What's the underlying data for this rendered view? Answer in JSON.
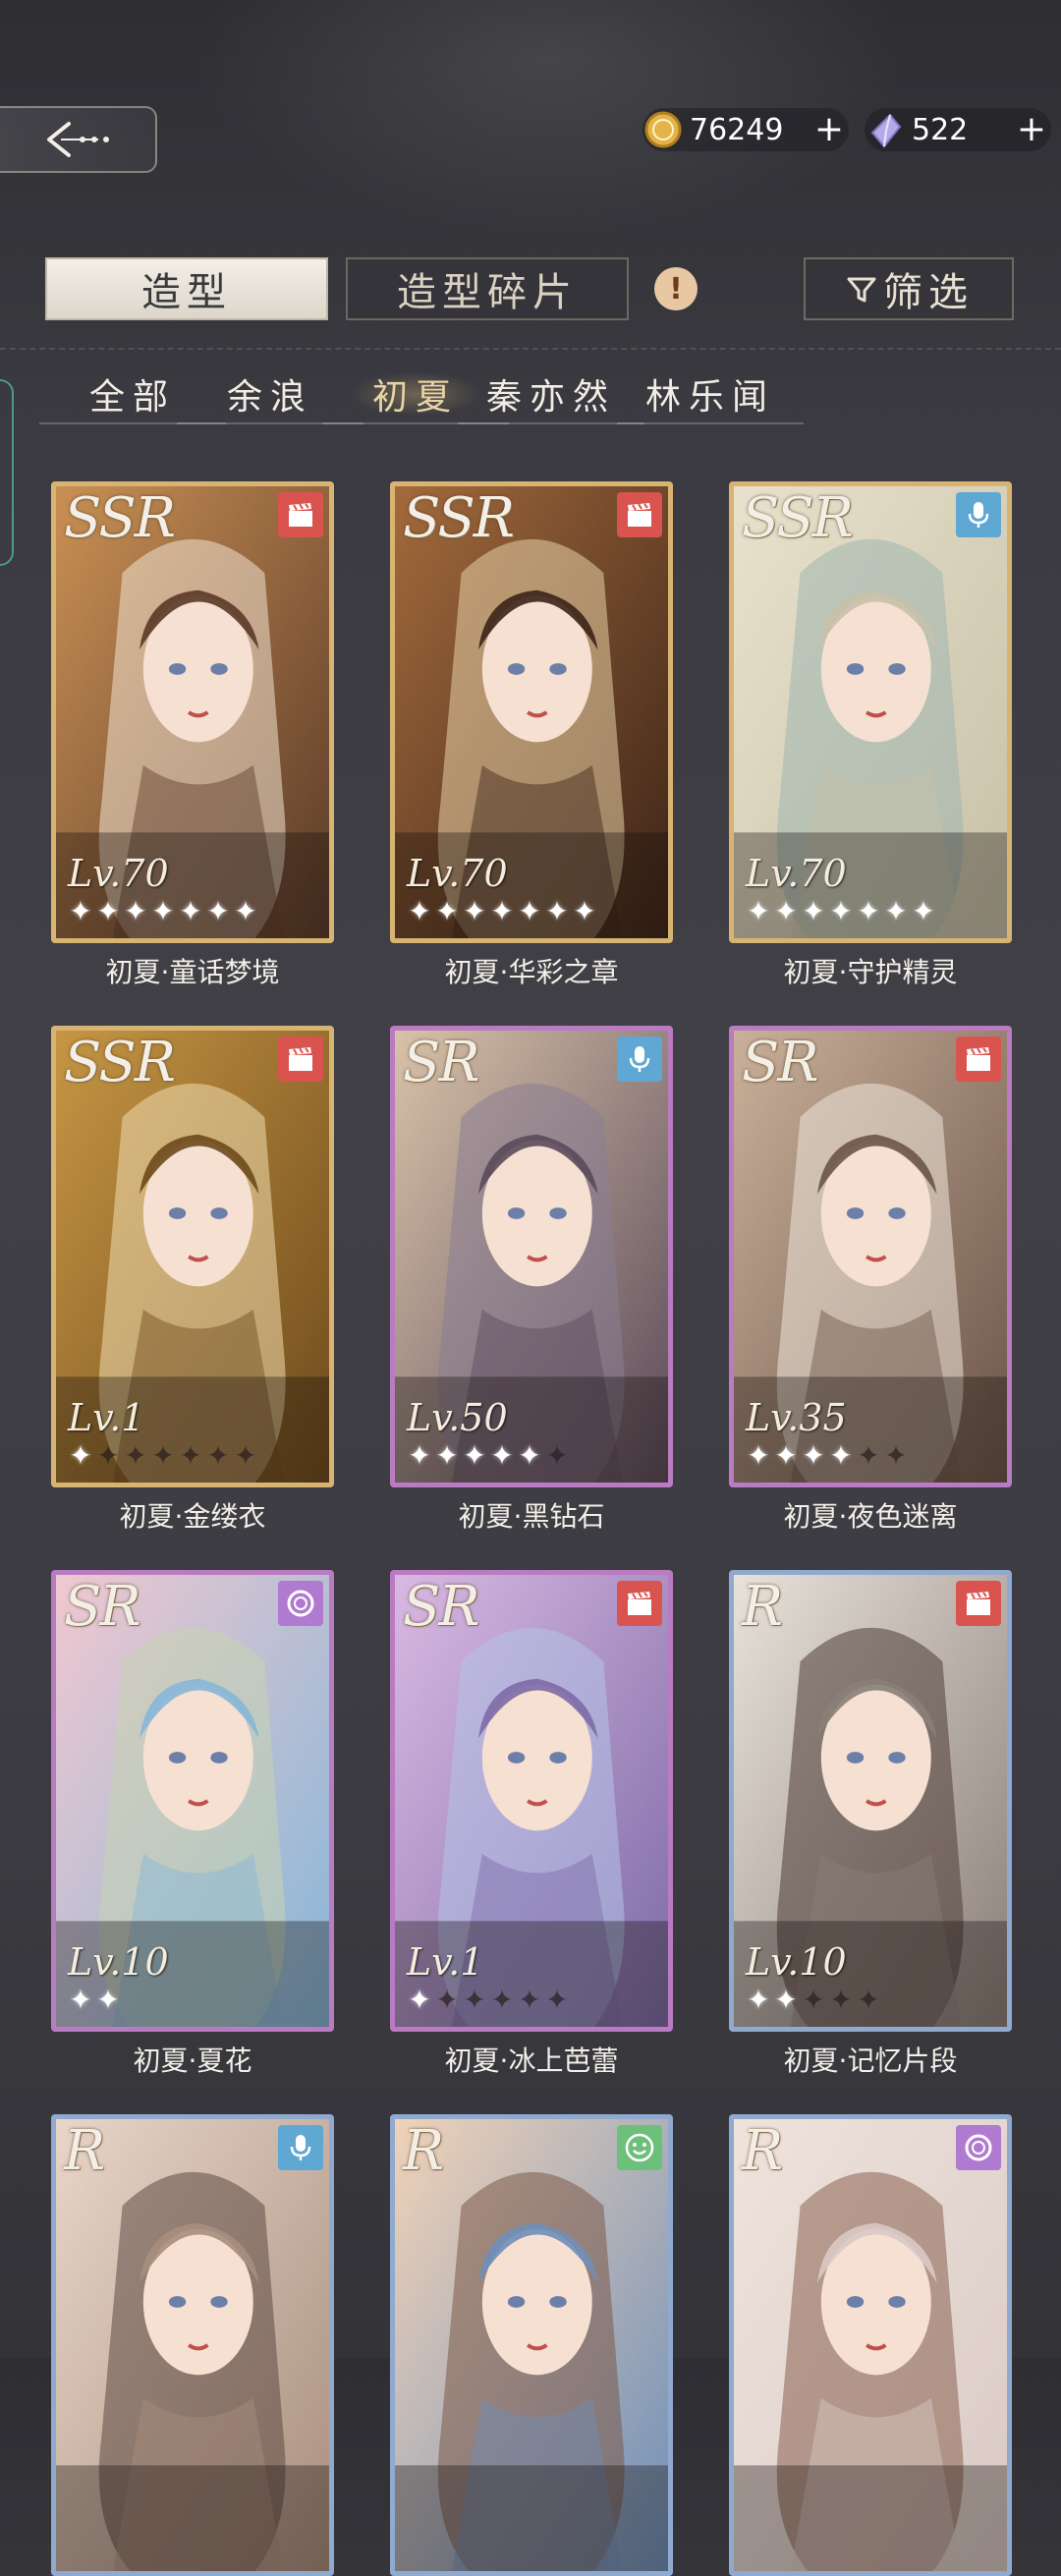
{
  "header": {
    "gold": "76249",
    "gems": "522",
    "plus": "+"
  },
  "tabs": {
    "outfit": "造型",
    "shards": "造型碎片",
    "alert": "!",
    "filter": "筛选"
  },
  "characters": [
    "全部",
    "余浪",
    "初夏",
    "秦亦然",
    "林乐闻"
  ],
  "active_character": "初夏",
  "cards": [
    {
      "rarity": "SSR",
      "level": "Lv.70",
      "stars": 7,
      "max_stars": 7,
      "type": "clapper-icon",
      "name": "初夏·童话梦境"
    },
    {
      "rarity": "SSR",
      "level": "Lv.70",
      "stars": 7,
      "max_stars": 7,
      "type": "clapper-icon",
      "name": "初夏·华彩之章"
    },
    {
      "rarity": "SSR",
      "level": "Lv.70",
      "stars": 7,
      "max_stars": 7,
      "type": "microphone-icon",
      "name": "初夏·守护精灵"
    },
    {
      "rarity": "SSR",
      "level": "Lv.1",
      "stars": 1,
      "max_stars": 7,
      "type": "clapper-icon",
      "name": "初夏·金缕衣"
    },
    {
      "rarity": "SR",
      "level": "Lv.50",
      "stars": 5,
      "max_stars": 6,
      "type": "microphone-icon",
      "name": "初夏·黑钻石"
    },
    {
      "rarity": "SR",
      "level": "Lv.35",
      "stars": 4,
      "max_stars": 6,
      "type": "clapper-icon",
      "name": "初夏·夜色迷离"
    },
    {
      "rarity": "SR",
      "level": "Lv.10",
      "stars": 2,
      "max_stars": 2,
      "type": "ring-icon",
      "name": "初夏·夏花"
    },
    {
      "rarity": "SR",
      "level": "Lv.1",
      "stars": 1,
      "max_stars": 6,
      "type": "clapper-icon",
      "name": "初夏·冰上芭蕾"
    },
    {
      "rarity": "R",
      "level": "Lv.10",
      "stars": 2,
      "max_stars": 5,
      "type": "clapper-icon",
      "name": "初夏·记忆片段"
    },
    {
      "rarity": "R",
      "level": "",
      "stars": 0,
      "max_stars": 0,
      "type": "microphone-icon",
      "name": ""
    },
    {
      "rarity": "R",
      "level": "",
      "stars": 0,
      "max_stars": 0,
      "type": "smile-icon",
      "name": ""
    },
    {
      "rarity": "R",
      "level": "",
      "stars": 0,
      "max_stars": 0,
      "type": "ring-icon",
      "name": ""
    }
  ],
  "colors": {
    "ssr_frame": "#d8b472",
    "sr_frame": "#b97bc2",
    "r_frame": "#8fa9cf",
    "active_tab_text": "#e8d3a6"
  }
}
